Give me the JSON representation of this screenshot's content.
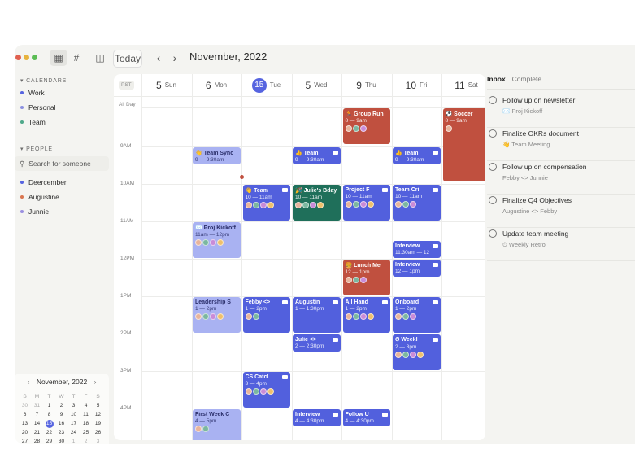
{
  "toolbar": {
    "today_label": "Today",
    "prev_label": "‹",
    "next_label": "›",
    "title": "November, 2022"
  },
  "sidebar": {
    "calendars_heading": "CALENDARS",
    "calendars": [
      {
        "label": "Work",
        "color": "#5664e0"
      },
      {
        "label": "Personal",
        "color": "#8b8fe0"
      },
      {
        "label": "Team",
        "color": "#4ea88a"
      }
    ],
    "people_heading": "PEOPLE",
    "search_placeholder": "Search for someone",
    "people": [
      {
        "label": "Deercember",
        "color": "#5664e0"
      },
      {
        "label": "Augustine",
        "color": "#d9754f"
      },
      {
        "label": "Junnie",
        "color": "#9a8fe0"
      }
    ]
  },
  "mini_calendar": {
    "title": "November, 2022",
    "weekdays": [
      "S",
      "M",
      "T",
      "W",
      "T",
      "F",
      "S"
    ],
    "weeks": [
      [
        "30",
        "31",
        "1",
        "2",
        "3",
        "4",
        "5"
      ],
      [
        "6",
        "7",
        "8",
        "9",
        "10",
        "11",
        "12"
      ],
      [
        "13",
        "14",
        "15",
        "16",
        "17",
        "18",
        "19"
      ],
      [
        "20",
        "21",
        "22",
        "23",
        "24",
        "25",
        "26"
      ],
      [
        "27",
        "28",
        "29",
        "30",
        "1",
        "2",
        "3"
      ],
      [
        "4",
        "5",
        "6",
        "7",
        "8",
        "9",
        "10"
      ]
    ]
  },
  "calendar": {
    "timezone": "PST",
    "all_day_label": "All Day",
    "days": [
      {
        "num": "5",
        "name": "Sun"
      },
      {
        "num": "6",
        "name": "Mon"
      },
      {
        "num": "15",
        "name": "Tue"
      },
      {
        "num": "5",
        "name": "Wed"
      },
      {
        "num": "9",
        "name": "Thu"
      },
      {
        "num": "10",
        "name": "Fri"
      },
      {
        "num": "11",
        "name": "Sat"
      }
    ],
    "hours": [
      "9AM",
      "10AM",
      "11AM",
      "12PM",
      "1PM",
      "2PM",
      "3PM",
      "4PM"
    ],
    "events": [
      {
        "day": 4,
        "start": 7.95,
        "end": 8.95,
        "title": "🏃 Group Run",
        "time": "8 — 9am",
        "style": "red",
        "avatars": 3
      },
      {
        "day": 6,
        "start": 7.95,
        "end": 9.95,
        "title": "⚽ Soccer",
        "time": "8 — 9am",
        "style": "red",
        "avatars": 1
      },
      {
        "day": 1,
        "start": 9.0,
        "end": 9.5,
        "title": "👋 Team Sync",
        "time": "9 — 9:30am",
        "style": "light",
        "avatars": 0
      },
      {
        "day": 3,
        "start": 9.0,
        "end": 9.5,
        "title": "👍 Team",
        "time": "9 — 9:30am",
        "style": "indigo",
        "cam": true,
        "avatars": 0
      },
      {
        "day": 5,
        "start": 9.0,
        "end": 9.5,
        "title": "👍 Team",
        "time": "9 — 9:30am",
        "style": "indigo",
        "cam": true,
        "avatars": 0
      },
      {
        "day": 2,
        "start": 10.0,
        "end": 11.0,
        "title": "👋 Team",
        "time": "10 — 11am",
        "style": "indigo",
        "cam": true,
        "avatars": 4
      },
      {
        "day": 3,
        "start": 10.0,
        "end": 11.0,
        "title": "🎉 Julie's Bday",
        "time": "10 — 11am",
        "style": "green",
        "avatars": 4
      },
      {
        "day": 4,
        "start": 10.0,
        "end": 11.0,
        "title": "Project F",
        "time": "10 — 11am",
        "style": "indigo",
        "cam": true,
        "avatars": 4
      },
      {
        "day": 5,
        "start": 10.0,
        "end": 11.0,
        "title": "Team Cri",
        "time": "10 — 11am",
        "style": "indigo",
        "cam": true,
        "avatars": 3
      },
      {
        "day": 1,
        "start": 11.0,
        "end": 12.0,
        "title": "✉️ Proj Kickoff",
        "time": "11am — 12pm",
        "style": "light",
        "avatars": 4
      },
      {
        "day": 5,
        "start": 11.5,
        "end": 12.0,
        "title": "Interview",
        "time": "11:30am — 12",
        "style": "indigo",
        "cam": true,
        "avatars": 0
      },
      {
        "day": 4,
        "start": 12.0,
        "end": 13.0,
        "title": "🍔 Lunch Me",
        "time": "12 — 1pm",
        "style": "red",
        "avatars": 3
      },
      {
        "day": 5,
        "start": 12.0,
        "end": 12.5,
        "title": "Interview",
        "time": "12 — 1pm",
        "style": "indigo",
        "cam": true,
        "avatars": 0
      },
      {
        "day": 1,
        "start": 13.0,
        "end": 14.0,
        "title": "Leadership S",
        "time": "1 — 2pm",
        "style": "light",
        "avatars": 4
      },
      {
        "day": 2,
        "start": 13.0,
        "end": 14.0,
        "title": "Febby <>",
        "time": "1 — 2pm",
        "style": "indigo",
        "cam": true,
        "avatars": 2
      },
      {
        "day": 3,
        "start": 13.0,
        "end": 14.0,
        "title": "Augustin",
        "time": "1 — 1:30pm",
        "style": "indigo",
        "cam": true,
        "avatars": 0
      },
      {
        "day": 4,
        "start": 13.0,
        "end": 14.0,
        "title": "All Hand",
        "time": "1 — 2pm",
        "style": "indigo",
        "cam": true,
        "avatars": 4
      },
      {
        "day": 5,
        "start": 13.0,
        "end": 14.0,
        "title": "Onboard",
        "time": "1 — 2pm",
        "style": "indigo",
        "cam": true,
        "avatars": 3
      },
      {
        "day": 3,
        "start": 14.0,
        "end": 14.5,
        "title": "Julie <>",
        "time": "2 — 2:30pm",
        "style": "indigo",
        "cam": true,
        "avatars": 0
      },
      {
        "day": 5,
        "start": 14.0,
        "end": 15.0,
        "title": "⏱ Weekl",
        "time": "2 — 3pm",
        "style": "indigo",
        "cam": true,
        "avatars": 4
      },
      {
        "day": 2,
        "start": 15.0,
        "end": 16.0,
        "title": "CS Catcl",
        "time": "3 — 4pm",
        "style": "indigo",
        "cam": true,
        "avatars": 4
      },
      {
        "day": 1,
        "start": 16.0,
        "end": 17.0,
        "title": "First Week C",
        "time": "4 — 5pm",
        "style": "light",
        "avatars": 2
      },
      {
        "day": 3,
        "start": 16.0,
        "end": 16.5,
        "title": "Interview",
        "time": "4 — 4:30pm",
        "style": "indigo",
        "cam": true,
        "avatars": 0
      },
      {
        "day": 4,
        "start": 16.0,
        "end": 16.5,
        "title": "Follow U",
        "time": "4 — 4:30pm",
        "style": "indigo",
        "cam": true,
        "avatars": 0
      }
    ],
    "now_hour": 9.8
  },
  "inbox": {
    "tabs": [
      "Inbox",
      "Complete"
    ],
    "tasks": [
      {
        "title": "Follow up on newsletter",
        "sub": "✉️ Proj Kickoff"
      },
      {
        "title": "Finalize OKRs document",
        "sub": "👋 Team Meeting"
      },
      {
        "title": "Follow up on compensation",
        "sub": "Febby <> Junnie"
      },
      {
        "title": "Finalize Q4 Objectives",
        "sub": "Augustine <> Febby"
      },
      {
        "title": "Update team meeting",
        "sub": "⏱ Weekly Retro"
      }
    ]
  }
}
